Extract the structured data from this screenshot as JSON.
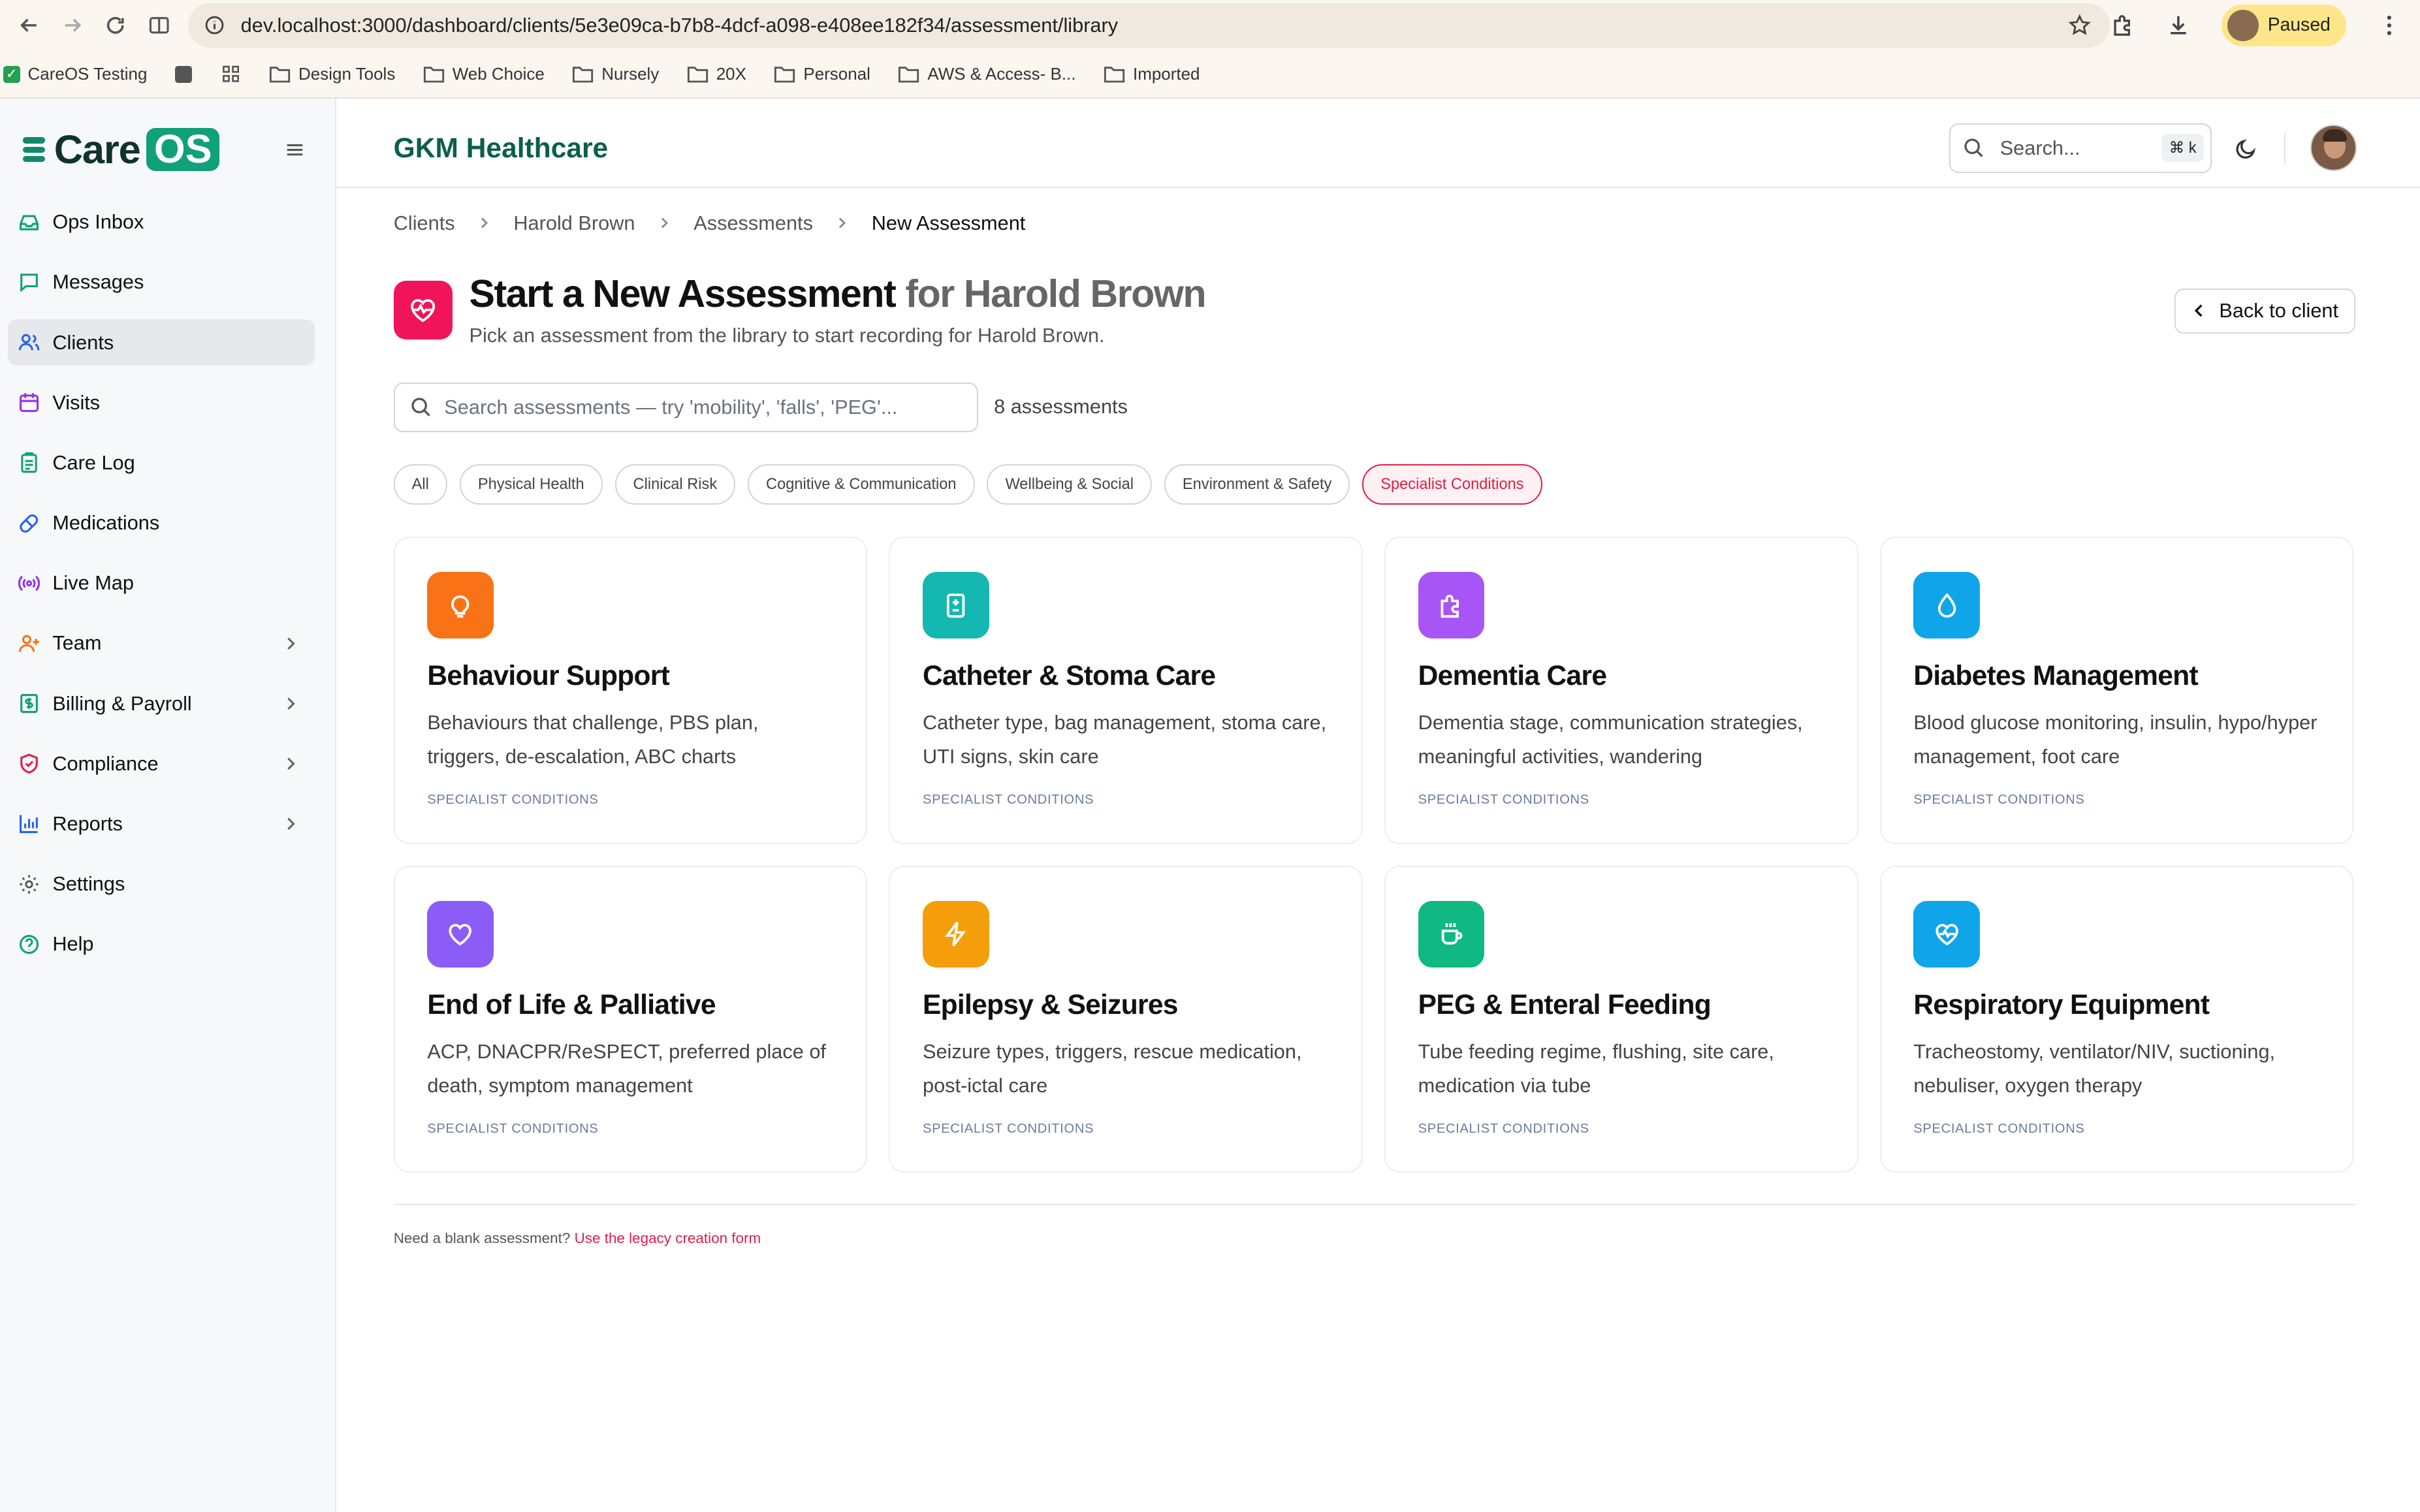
{
  "browser": {
    "url": "dev.localhost:3000/dashboard/clients/5e3e09ca-b7b8-4dcf-a098-e408ee182f34/assessment/library",
    "profile_status": "Paused",
    "bookmarks": [
      "CareOS Testing",
      "Design Tools",
      "Web Choice",
      "Nursely",
      "20X",
      "Personal",
      "AWS & Access- B...",
      "Imported"
    ]
  },
  "app": {
    "logo_care": "Care",
    "logo_os": "OS",
    "org_name": "GKM Healthcare",
    "search_placeholder": "Search...",
    "search_shortcut": "⌘ k"
  },
  "sidebar": {
    "items": [
      {
        "label": "Ops Inbox",
        "icon": "inbox-icon",
        "color": "#10a07a"
      },
      {
        "label": "Messages",
        "icon": "message-icon",
        "color": "#10a07a"
      },
      {
        "label": "Clients",
        "icon": "users-icon",
        "color": "#2563eb"
      },
      {
        "label": "Visits",
        "icon": "calendar-icon",
        "color": "#9333ea"
      },
      {
        "label": "Care Log",
        "icon": "clipboard-icon",
        "color": "#10a07a"
      },
      {
        "label": "Medications",
        "icon": "pill-icon",
        "color": "#2563eb"
      },
      {
        "label": "Live Map",
        "icon": "radio-icon",
        "color": "#9333ea"
      },
      {
        "label": "Team",
        "icon": "user-plus-icon",
        "color": "#f97316"
      },
      {
        "label": "Billing & Payroll",
        "icon": "receipt-icon",
        "color": "#10a07a"
      },
      {
        "label": "Compliance",
        "icon": "shield-icon",
        "color": "#e11d48"
      },
      {
        "label": "Reports",
        "icon": "bar-chart-icon",
        "color": "#2563eb"
      },
      {
        "label": "Settings",
        "icon": "gear-icon",
        "color": "#555555"
      },
      {
        "label": "Help",
        "icon": "help-icon",
        "color": "#10a07a"
      }
    ]
  },
  "breadcrumb": [
    "Clients",
    "Harold Brown",
    "Assessments",
    "New Assessment"
  ],
  "header": {
    "title": "Start a New Assessment",
    "title_for": "for Harold Brown",
    "subtitle": "Pick an assessment from the library to start recording for Harold Brown.",
    "back_label": "Back to client"
  },
  "assessment_search": {
    "placeholder": "Search assessments — try 'mobility', 'falls', 'PEG'...",
    "count": "8 assessments"
  },
  "filters": {
    "items": [
      "All",
      "Physical Health",
      "Clinical Risk",
      "Cognitive & Communication",
      "Wellbeing & Social",
      "Environment & Safety",
      "Specialist Conditions"
    ],
    "active": "Specialist Conditions"
  },
  "cards": [
    {
      "title": "Behaviour Support",
      "desc": "Behaviours that challenge, PBS plan, triggers, de-escalation, ABC charts",
      "tag": "SPECIALIST CONDITIONS",
      "icon": "lightbulb-icon",
      "color": "#f97316"
    },
    {
      "title": "Catheter & Stoma Care",
      "desc": "Catheter type, bag management, stoma care, UTI signs, skin care",
      "tag": "SPECIALIST CONDITIONS",
      "icon": "hospital-icon",
      "color": "#14b8b0"
    },
    {
      "title": "Dementia Care",
      "desc": "Dementia stage, communication strategies, meaningful activities, wandering",
      "tag": "SPECIALIST CONDITIONS",
      "icon": "puzzle-icon",
      "color": "#a855f7"
    },
    {
      "title": "Diabetes Management",
      "desc": "Blood glucose monitoring, insulin, hypo/hyper management, foot care",
      "tag": "SPECIALIST CONDITIONS",
      "icon": "droplet-icon",
      "color": "#0ea5e9"
    },
    {
      "title": "End of Life & Palliative",
      "desc": "ACP, DNACPR/ReSPECT, preferred place of death, symptom management",
      "tag": "SPECIALIST CONDITIONS",
      "icon": "heart-icon",
      "color": "#8b5cf6"
    },
    {
      "title": "Epilepsy & Seizures",
      "desc": "Seizure types, triggers, rescue medication, post-ictal care",
      "tag": "SPECIALIST CONDITIONS",
      "icon": "zap-icon",
      "color": "#f59e0b"
    },
    {
      "title": "PEG & Enteral Feeding",
      "desc": "Tube feeding regime, flushing, site care, medication via tube",
      "tag": "SPECIALIST CONDITIONS",
      "icon": "cup-icon",
      "color": "#10b981"
    },
    {
      "title": "Respiratory Equipment",
      "desc": "Tracheostomy, ventilator/NIV, suctioning, nebuliser, oxygen therapy",
      "tag": "SPECIALIST CONDITIONS",
      "icon": "heart-pulse-icon",
      "color": "#0ea5e9"
    }
  ],
  "footer": {
    "text": "Need a blank assessment?",
    "link": "Use the legacy creation form"
  }
}
